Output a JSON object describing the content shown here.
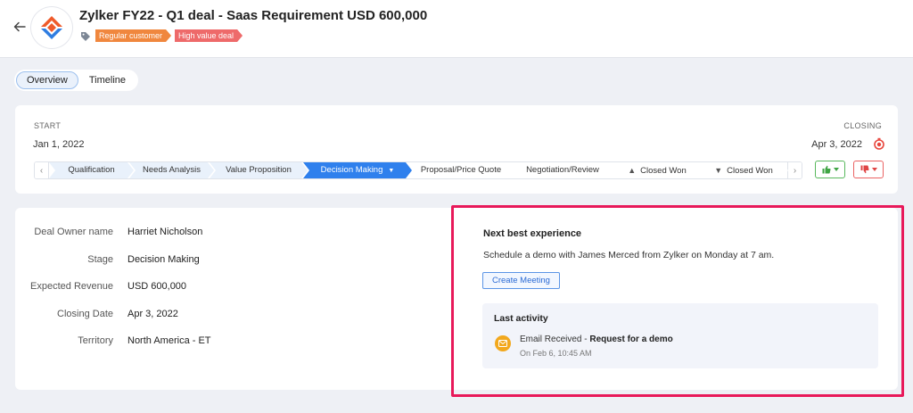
{
  "header": {
    "title": "Zylker FY22 - Q1 deal - Saas Requirement USD 600,000",
    "tags": [
      "Regular customer",
      "High value deal"
    ]
  },
  "tabs": [
    {
      "label": "Overview",
      "active": true
    },
    {
      "label": "Timeline",
      "active": false
    }
  ],
  "stages": {
    "start_label": "START",
    "closing_label": "CLOSING",
    "start_date": "Jan 1, 2022",
    "closing_date": "Apr 3, 2022",
    "steps": [
      {
        "label": "Qualification",
        "state": "done"
      },
      {
        "label": "Needs Analysis",
        "state": "done"
      },
      {
        "label": "Value Proposition",
        "state": "done"
      },
      {
        "label": "Decision Making",
        "state": "current"
      },
      {
        "label": "Proposal/Price Quote",
        "state": "todo"
      },
      {
        "label": "Negotiation/Review",
        "state": "todo"
      },
      {
        "label": "Closed Won",
        "state": "todo",
        "icon": "thumbs-up-icon"
      },
      {
        "label": "Closed Won",
        "state": "todo",
        "icon": "thumbs-down-icon"
      }
    ],
    "won_color": "#58b85c",
    "lost_color": "#ea6262"
  },
  "details": {
    "fields": [
      {
        "label": "Deal Owner name",
        "value": "Harriet Nicholson"
      },
      {
        "label": "Stage",
        "value": "Decision Making"
      },
      {
        "label": "Expected Revenue",
        "value": "USD 600,000"
      },
      {
        "label": "Closing Date",
        "value": "Apr 3, 2022"
      },
      {
        "label": "Territory",
        "value": "North America - ET"
      }
    ]
  },
  "nbe": {
    "title": "Next best experience",
    "text": "Schedule a demo with James Merced from Zylker on Monday at 7 am.",
    "button": "Create Meeting",
    "activity": {
      "title": "Last activity",
      "type": "Email Received",
      "separator": " - ",
      "subject": "Request for a demo",
      "time": "On Feb 6, 10:45 AM"
    }
  },
  "colors": {
    "accent": "#2f80ed",
    "highlight": "#e8195a",
    "tag_regular": "#f0873e",
    "tag_high_value": "#ee6a6a"
  }
}
